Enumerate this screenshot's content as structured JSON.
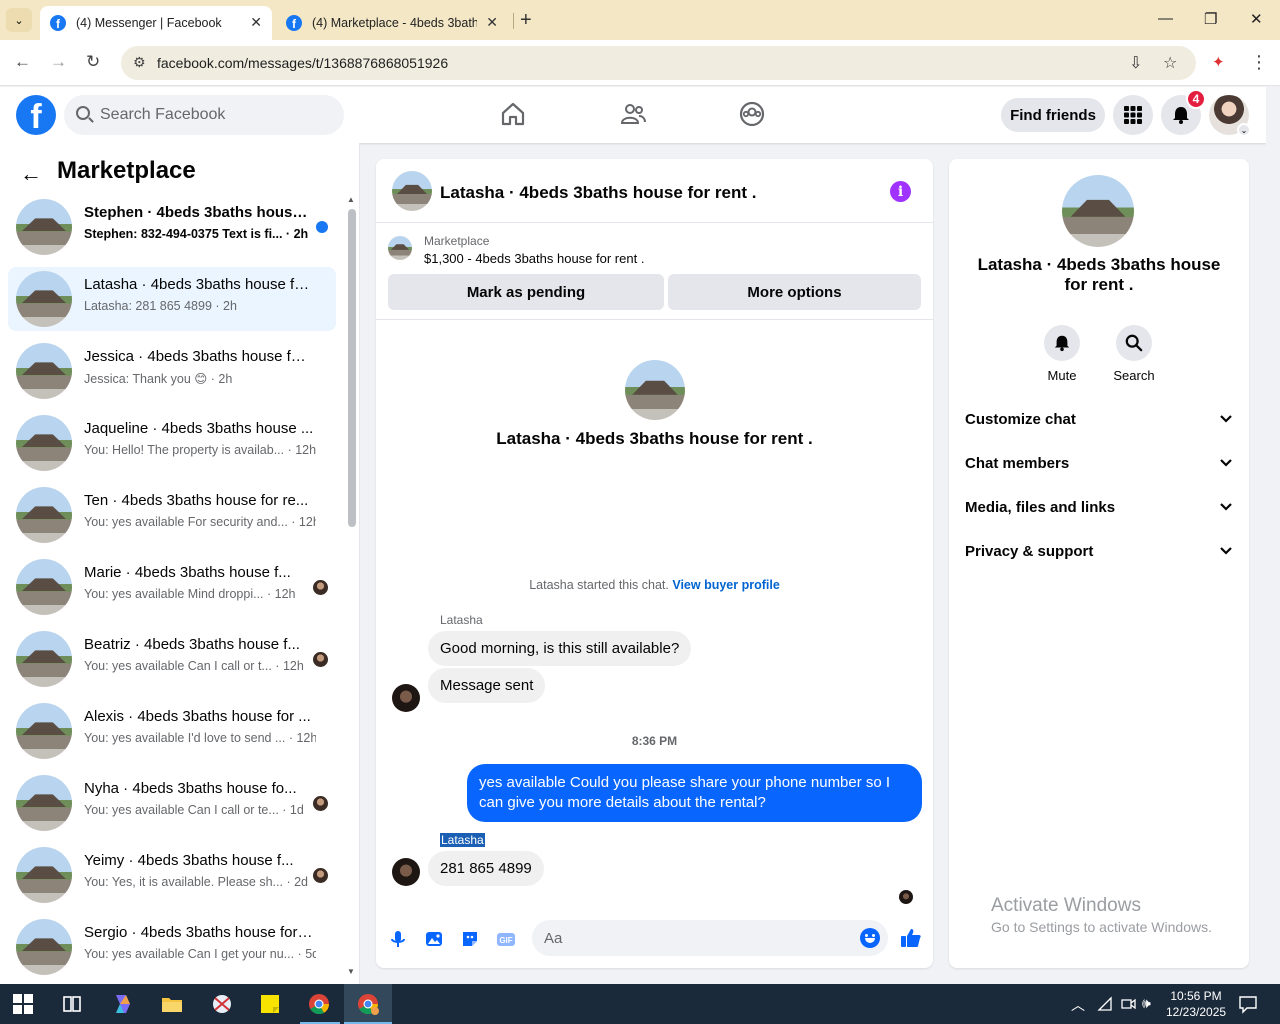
{
  "browser": {
    "tabs": [
      {
        "title": "(4) Messenger | Facebook",
        "active": true
      },
      {
        "title": "(4) Marketplace - 4beds 3baths",
        "active": false
      }
    ],
    "url": "facebook.com/messages/t/1368876868051926"
  },
  "fbnav": {
    "search_placeholder": "Search Facebook",
    "find_friends": "Find friends",
    "notification_count": "4"
  },
  "left_panel": {
    "title": "Marketplace",
    "conversations": [
      {
        "name": "Stephen · 4beds 3baths house ...",
        "snippet": "Stephen: 832-494-0375 Text is fi... · 2h",
        "unread": true,
        "active": false
      },
      {
        "name": "Latasha · 4beds 3baths house fo...",
        "snippet": "Latasha: 281 865 4899 · 2h",
        "unread": false,
        "active": true
      },
      {
        "name": "Jessica · 4beds 3baths house for...",
        "snippet": "Jessica: Thank you 😊 · 2h",
        "unread": false,
        "active": false
      },
      {
        "name": "Jaqueline · 4beds 3baths house ...",
        "snippet": "You: Hello! The property is availab... · 12h",
        "unread": false,
        "active": false
      },
      {
        "name": "Ten · 4beds 3baths house for re...",
        "snippet": "You: yes available For security and... · 12h",
        "unread": false,
        "active": false
      },
      {
        "name": "Marie · 4beds 3baths house f...",
        "snippet": "You: yes available Mind droppi... · 12h",
        "unread": false,
        "active": false
      },
      {
        "name": "Beatriz · 4beds 3baths house f...",
        "snippet": "You: yes available Can I call or t... · 12h",
        "unread": false,
        "active": false
      },
      {
        "name": "Alexis · 4beds 3baths house for ...",
        "snippet": "You: yes available I'd love to send ... · 12h",
        "unread": false,
        "active": false
      },
      {
        "name": "Nyha · 4beds 3baths house fo...",
        "snippet": "You: yes available Can I call or te... · 1d",
        "unread": false,
        "active": false
      },
      {
        "name": "Yeimy · 4beds 3baths house f...",
        "snippet": "You: Yes, it is available. Please sh... · 2d",
        "unread": false,
        "active": false
      },
      {
        "name": "Sergio · 4beds 3baths house for ...",
        "snippet": "You: yes available Can I get your nu... · 5d",
        "unread": false,
        "active": false
      }
    ]
  },
  "chat": {
    "title": "Latasha · 4beds 3baths house for rent .",
    "marketplace_label": "Marketplace",
    "listing": "$1,300 - 4beds 3baths house for rent .",
    "mark_pending": "Mark as pending",
    "more_options": "More options",
    "center_name": "Latasha · 4beds 3baths house for rent .",
    "started_text": "Latasha started this chat.",
    "view_profile": "View buyer profile",
    "sender1": "Latasha",
    "msg1": "Good morning, is this still available?",
    "msg2": "Message sent",
    "time": "8:36 PM",
    "msg_out": "yes available Could you please share your phone number so I can give you more details about the rental?",
    "sender2": "Latasha",
    "msg3": "281 865 4899",
    "input_placeholder": "Aa"
  },
  "details": {
    "name": "Latasha · 4beds 3baths house for rent .",
    "mute": "Mute",
    "search": "Search",
    "sections": [
      "Customize chat",
      "Chat members",
      "Media, files and links",
      "Privacy & support"
    ]
  },
  "watermark": {
    "line1": "Activate Windows",
    "line2": "Go to Settings to activate Windows."
  },
  "taskbar": {
    "time": "10:56 PM",
    "date": "12/23/2025"
  },
  "colors": {
    "fb_blue": "#1877f2",
    "messenger_blue": "#0866ff",
    "active_row": "#ebf5ff",
    "info_purple": "#a033ff"
  }
}
